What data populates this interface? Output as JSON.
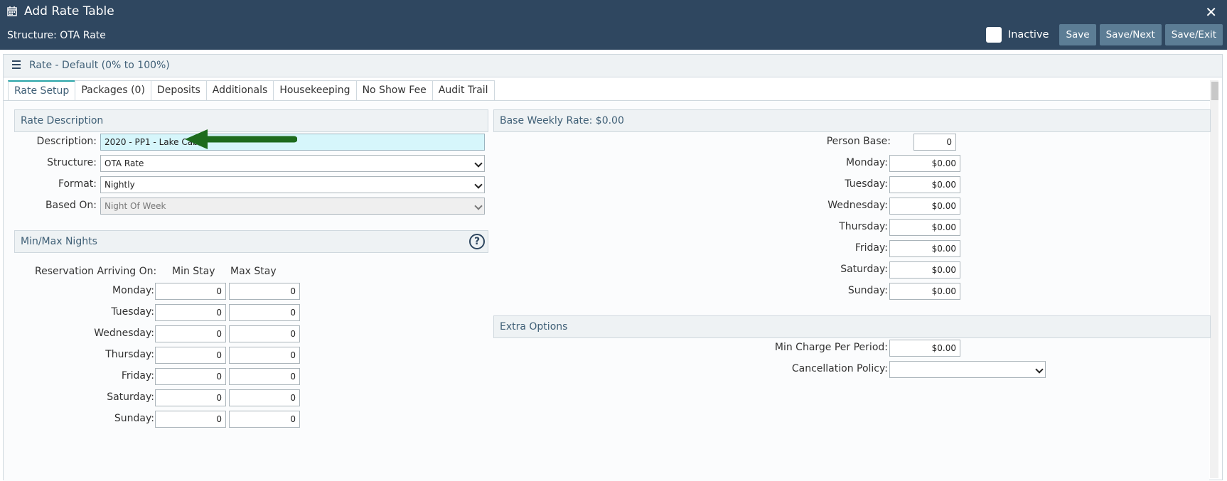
{
  "header": {
    "title": "Add Rate Table",
    "structure": "Structure: OTA Rate",
    "inactive_label": "Inactive",
    "close": "✕",
    "buttons": {
      "save": "Save",
      "save_next": "Save/Next",
      "save_exit": "Save/Exit"
    }
  },
  "rate": {
    "title": "Rate - Default (0% to 100%)"
  },
  "tabs": [
    {
      "label": "Rate Setup",
      "active": true
    },
    {
      "label": "Packages (0)"
    },
    {
      "label": "Deposits"
    },
    {
      "label": "Additionals"
    },
    {
      "label": "Housekeeping"
    },
    {
      "label": "No Show Fee"
    },
    {
      "label": "Audit Trail"
    }
  ],
  "rate_description": {
    "title": "Rate Description",
    "description_label": "Description:",
    "description_value": "2020 - PP1 - Lake Cabin",
    "structure_label": "Structure:",
    "structure_value": "OTA Rate",
    "format_label": "Format:",
    "format_value": "Nightly",
    "based_on_label": "Based On:",
    "based_on_value": "Night Of Week"
  },
  "min_max": {
    "title": "Min/Max Nights",
    "help": "?",
    "arriving_label": "Reservation Arriving On:",
    "min_label": "Min Stay",
    "max_label": "Max Stay",
    "days": [
      {
        "label": "Monday:",
        "min": "0",
        "max": "0"
      },
      {
        "label": "Tuesday:",
        "min": "0",
        "max": "0"
      },
      {
        "label": "Wednesday:",
        "min": "0",
        "max": "0"
      },
      {
        "label": "Thursday:",
        "min": "0",
        "max": "0"
      },
      {
        "label": "Friday:",
        "min": "0",
        "max": "0"
      },
      {
        "label": "Saturday:",
        "min": "0",
        "max": "0"
      },
      {
        "label": "Sunday:",
        "min": "0",
        "max": "0"
      }
    ]
  },
  "base_weekly": {
    "title": "Base Weekly Rate: $0.00",
    "person_base_label": "Person Base:",
    "person_base_value": "0",
    "days": [
      {
        "label": "Monday:",
        "value": "$0.00"
      },
      {
        "label": "Tuesday:",
        "value": "$0.00"
      },
      {
        "label": "Wednesday:",
        "value": "$0.00"
      },
      {
        "label": "Thursday:",
        "value": "$0.00"
      },
      {
        "label": "Friday:",
        "value": "$0.00"
      },
      {
        "label": "Saturday:",
        "value": "$0.00"
      },
      {
        "label": "Sunday:",
        "value": "$0.00"
      }
    ]
  },
  "extra_options": {
    "title": "Extra Options",
    "min_charge_label": "Min Charge Per Period:",
    "min_charge_value": "$0.00",
    "cancellation_label": "Cancellation Policy:",
    "cancellation_value": ""
  },
  "colors": {
    "header_bg": "#2f4760",
    "button_bg": "#5c7d95",
    "tab_accent": "#2aa4a8",
    "arrow": "#1d6b1d"
  }
}
